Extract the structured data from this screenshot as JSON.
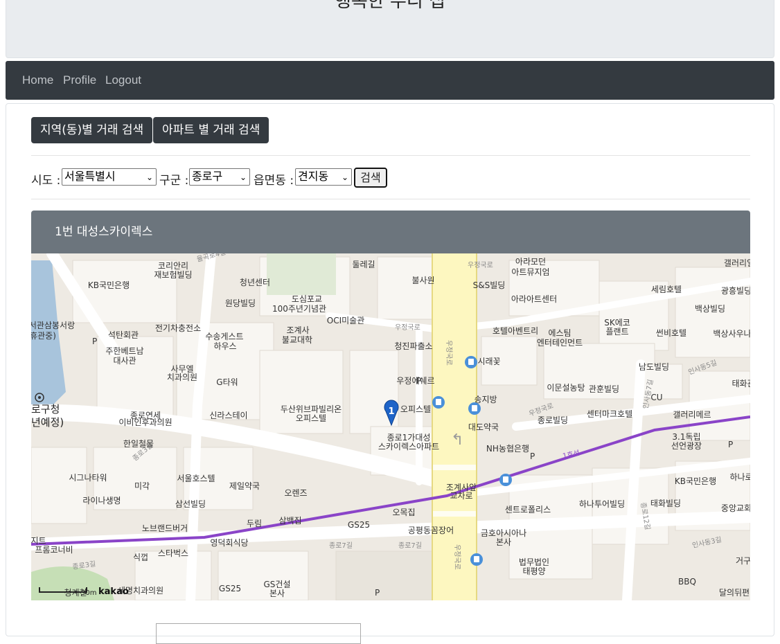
{
  "banner": {
    "title": "행복한 우리 집"
  },
  "nav": {
    "items": [
      "Home",
      "Profile",
      "Logout"
    ]
  },
  "tabs": {
    "by_region": "지역(동)별 거래 검색",
    "by_apartment": "아파트 별 거래 검색"
  },
  "filters": {
    "sido_label": "시도 :",
    "sido_value": "서울특별시",
    "gugun_label": "구군 :",
    "gugun_value": "종로구",
    "dong_label": "읍면동 :",
    "dong_value": "견지동",
    "search_label": "검색"
  },
  "result": {
    "header": "1번 대성스카이렉스"
  },
  "map": {
    "marker_number": "1",
    "scale": "30m",
    "brand": "kakao",
    "line_color": "#8a44c8",
    "labels": {
      "koreanthis": "코리안리\n재보험빌딩",
      "kb1": "KB국민은행",
      "youth": "청년센터",
      "wondang": "원당빌딩",
      "dosim": "도심포교",
      "centennial": "100주년기념관",
      "oci": "OCI미술관",
      "dulegil": "둘레길",
      "bulsawon": "불사원",
      "ss": "S&S빌딩",
      "aramo": "아라모던",
      "aramo2": "아트뮤지엄",
      "araart": "아라아트센터",
      "serim": "세림호텔",
      "gwangheung": "광흥빌딩",
      "baeksang": "백상빌딩",
      "baeksangsaun": "백상사우나",
      "gallery_top": "갤러리일",
      "jeon": "서관삼봉서랑",
      "jeon2": "휴관중)",
      "seoktan": "석탄회관",
      "ev": "전기차충전소",
      "susong": "수송게스트",
      "susong2": "하우스",
      "jogyesa": "조계사",
      "jogyesa2": "불교대학",
      "cheongjin": "청진파출소",
      "hotel_a": "호텔아벤트리",
      "esteem": "에스팀",
      "esteem2": "엔터테인먼트",
      "sk": "SK에코",
      "sk2": "플랜트",
      "ssenbi": "썬비호텔",
      "juhan": "주한베트남",
      "juhan2": "대사관",
      "saeul": "사무엘",
      "saeul2": "치과의원",
      "gtower": "G타워",
      "sirae": "시래꽃",
      "namdo": "남도빌딩",
      "idm": "이문설농탕",
      "gwanhun": "관훈빌딩",
      "cu": "CU",
      "taehwa": "태화관",
      "woojeong": "우정에쉐르",
      "woojeong2": "오피스텔",
      "songjibang": "송지방",
      "ward": "로구청",
      "ward2": "년예정)",
      "jongro_yonse": "종로연세",
      "jongro_yonse2": "이비인후과의원",
      "shilla": "신라스테이",
      "doosan": "두산위브파빌리온",
      "doosan2": "오피스텔",
      "daedo": "대도약국",
      "jongro_bldg": "종로빌딩",
      "centermark": "센터마크호텔",
      "gallery_m": "갤러리메르",
      "dokrip": "3.1독립",
      "dokrip2": "선언광장",
      "hanil": "한일철물",
      "skyrex": "종로1가대성",
      "skyrex2": "스카이렉스아파트",
      "nh": "NH농협은행",
      "signature": "시그나타워",
      "migak": "미각",
      "seoul_hostel": "서울호스텔",
      "jeil": "제일약국",
      "orence": "오렌즈",
      "kb2": "KB국민은행",
      "hana_r": "하나로",
      "jogye_int": "조계사앞",
      "jogye_int2": "교차로",
      "raina": "라이나생명",
      "samsun": "삼선빌딩",
      "dorim": "두림",
      "sambaek": "삼백집",
      "gs25_a": "GS25",
      "omok": "오목집",
      "centro": "센트로폴리스",
      "hanatour": "하나투어빌딩",
      "taehwa_b": "태화빌딩",
      "jungang": "중앙교회",
      "noble": "노브랜드버거",
      "gongpyeong": "공평동꼼장어",
      "geumho": "금호아시아나",
      "geumho2": "본사",
      "artt": "아지트",
      "prom": "프롬코너비",
      "sikgup": "식껍",
      "starbucks": "스타벅스",
      "youngduk": "영덕회식당",
      "taepyeong": "법무법인",
      "taepyeong2": "태평양",
      "bbq": "BBQ",
      "dalui": "달의뒤편",
      "geoku": "거구",
      "gs25_b": "GS25",
      "gs_const": "GS건설",
      "gs_const2": "본사",
      "semyung": "세명치과의원",
      "cheonggye": "청계천"
    },
    "roads": {
      "r1": "우정국로",
      "r2": "우정국로",
      "r3": "종로7길",
      "r4": "종로7길",
      "r5": "인사동7길",
      "r6": "인사동3길",
      "r7": "종로12길",
      "r8": "종로3길",
      "r9": "1호선",
      "r10": "종로3길",
      "r11": "인사동5길",
      "r12": "우정국로",
      "r13": "율곡로4길",
      "r14": "우정국로",
      "r15": "우정국로"
    }
  }
}
